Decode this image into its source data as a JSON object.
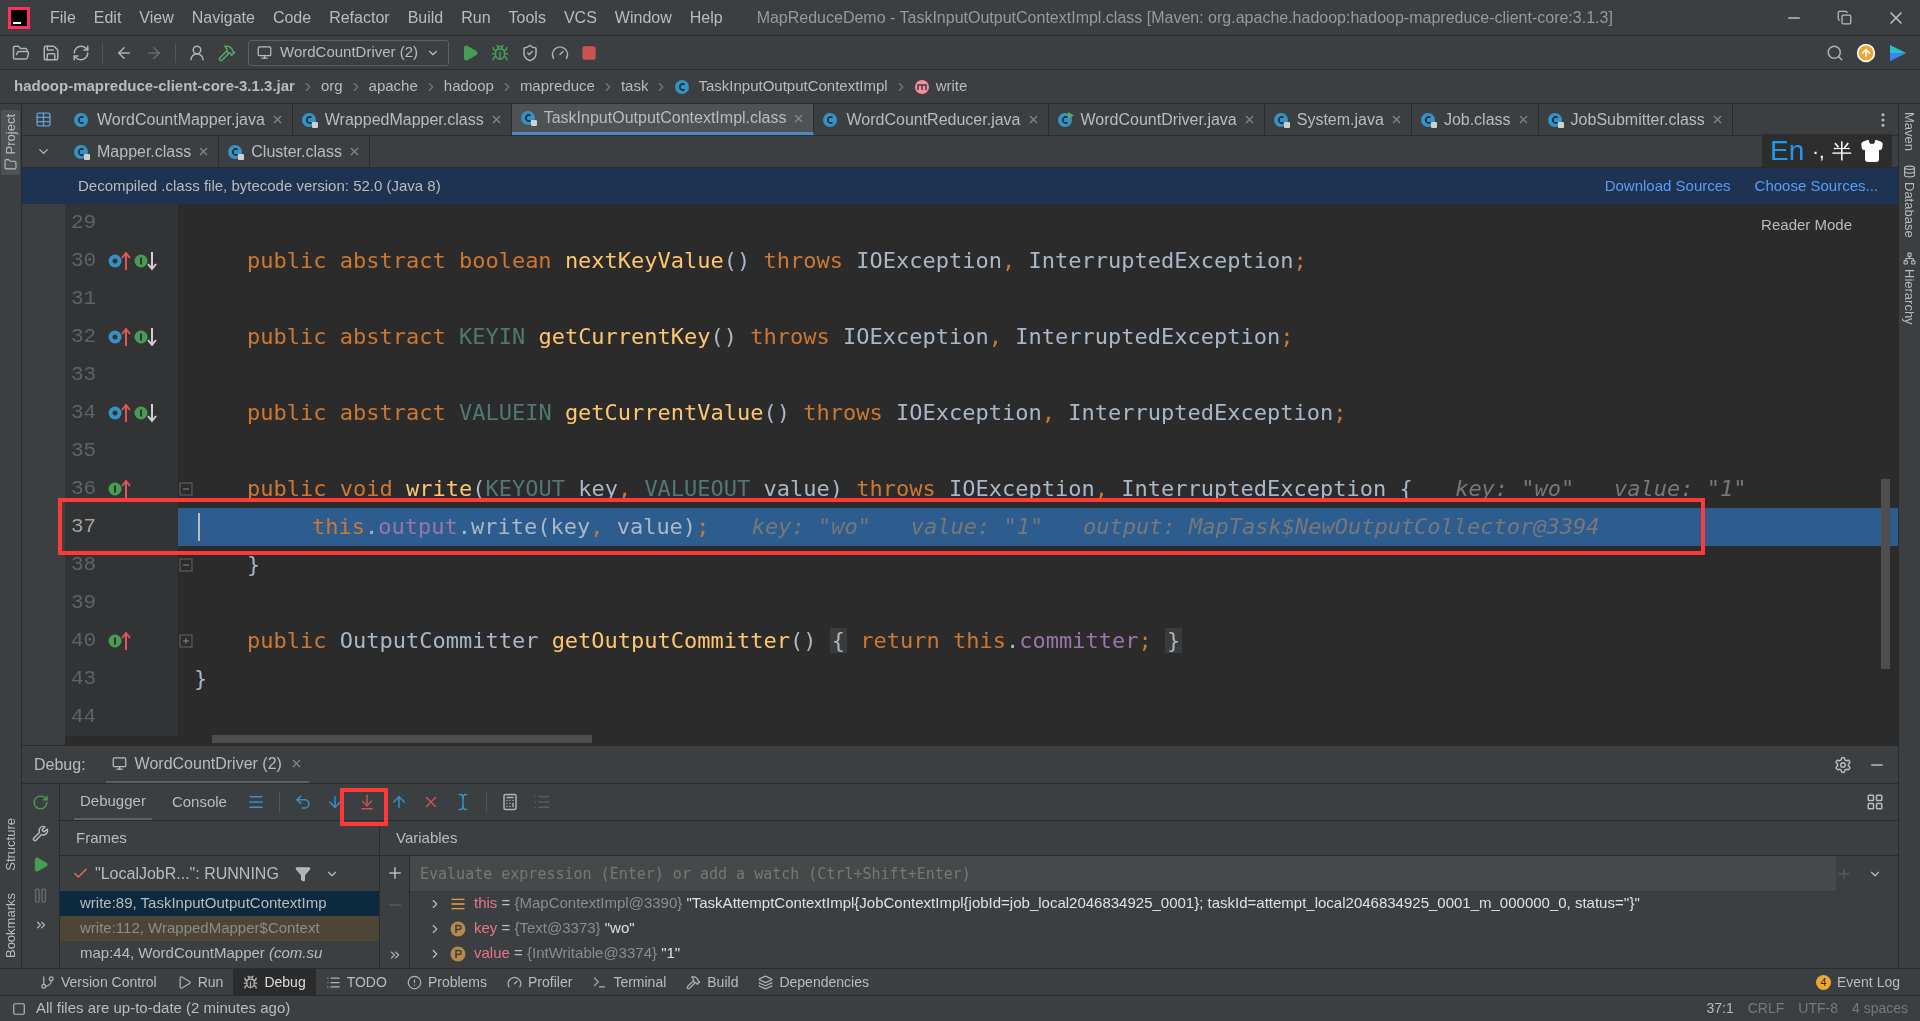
{
  "window": {
    "title": "MapReduceDemo - TaskInputOutputContextImpl.class [Maven: org.apache.hadoop:hadoop-mapreduce-client-core:3.1.3]"
  },
  "menu": [
    "File",
    "Edit",
    "View",
    "Navigate",
    "Code",
    "Refactor",
    "Build",
    "Run",
    "Tools",
    "VCS",
    "Window",
    "Help"
  ],
  "toolbar": {
    "run_config": "WordCountDriver (2)"
  },
  "breadcrumbs": [
    {
      "label": "hadoop-mapreduce-client-core-3.1.3.jar",
      "kind": "jar"
    },
    {
      "label": "org",
      "kind": "package"
    },
    {
      "label": "apache",
      "kind": "package"
    },
    {
      "label": "hadoop",
      "kind": "package"
    },
    {
      "label": "mapreduce",
      "kind": "package"
    },
    {
      "label": "task",
      "kind": "package"
    },
    {
      "label": "TaskInputOutputContextImpl",
      "kind": "class"
    },
    {
      "label": "write",
      "kind": "method"
    }
  ],
  "tab_rows": [
    {
      "tabs": [
        {
          "label": "WordCountMapper.java",
          "kind": "source",
          "selected": false
        },
        {
          "label": "WrappedMapper.class",
          "kind": "library",
          "selected": false
        },
        {
          "label": "TaskInputOutputContextImpl.class",
          "kind": "library",
          "selected": true
        },
        {
          "label": "WordCountReducer.java",
          "kind": "source",
          "selected": false
        },
        {
          "label": "WordCountDriver.java",
          "kind": "runnable",
          "selected": false
        },
        {
          "label": "System.java",
          "kind": "library",
          "selected": false
        },
        {
          "label": "Job.class",
          "kind": "library",
          "selected": false
        },
        {
          "label": "JobSubmitter.class",
          "kind": "library",
          "selected": false
        }
      ]
    },
    {
      "tabs": [
        {
          "label": "Mapper.class",
          "kind": "library",
          "selected": false
        },
        {
          "label": "Cluster.class",
          "kind": "library",
          "selected": false
        }
      ]
    }
  ],
  "banner": {
    "text": "Decompiled .class file, bytecode version: 52.0 (Java 8)",
    "links": [
      "Download Sources",
      "Choose Sources..."
    ]
  },
  "ime": {
    "mode": "En",
    "punct": "·,",
    "width": "半"
  },
  "reader_mode": "Reader Mode",
  "code_lines": [
    {
      "number": "29",
      "current": false
    },
    {
      "number": "30",
      "current": false,
      "markers": [
        {
          "kind": "o_up"
        },
        {
          "kind": "i_down"
        }
      ],
      "tokens": [
        {
          "kind": "kw",
          "text": "    public abstract boolean "
        },
        {
          "kind": "fn",
          "text": "nextKeyValue"
        },
        {
          "kind": "plain",
          "text": "() "
        },
        {
          "kind": "kw",
          "text": "throws "
        },
        {
          "kind": "plain",
          "text": "IOException"
        },
        {
          "kind": "kw",
          "text": ", "
        },
        {
          "kind": "plain",
          "text": "InterruptedException"
        },
        {
          "kind": "kw",
          "text": ";"
        }
      ]
    },
    {
      "number": "31",
      "current": false
    },
    {
      "number": "32",
      "current": false,
      "markers": [
        {
          "kind": "o_up"
        },
        {
          "kind": "i_down"
        }
      ],
      "tokens": [
        {
          "kind": "kw",
          "text": "    public abstract "
        },
        {
          "kind": "type",
          "text": "KEYIN "
        },
        {
          "kind": "fn",
          "text": "getCurrentKey"
        },
        {
          "kind": "plain",
          "text": "() "
        },
        {
          "kind": "kw",
          "text": "throws "
        },
        {
          "kind": "plain",
          "text": "IOException"
        },
        {
          "kind": "kw",
          "text": ", "
        },
        {
          "kind": "plain",
          "text": "InterruptedException"
        },
        {
          "kind": "kw",
          "text": ";"
        }
      ]
    },
    {
      "number": "33",
      "current": false
    },
    {
      "number": "34",
      "current": false,
      "markers": [
        {
          "kind": "o_up"
        },
        {
          "kind": "i_down"
        }
      ],
      "tokens": [
        {
          "kind": "kw",
          "text": "    public abstract "
        },
        {
          "kind": "type",
          "text": "VALUEIN "
        },
        {
          "kind": "fn",
          "text": "getCurrentValue"
        },
        {
          "kind": "plain",
          "text": "() "
        },
        {
          "kind": "kw",
          "text": "throws "
        },
        {
          "kind": "plain",
          "text": "IOException"
        },
        {
          "kind": "kw",
          "text": ", "
        },
        {
          "kind": "plain",
          "text": "InterruptedException"
        },
        {
          "kind": "kw",
          "text": ";"
        }
      ]
    },
    {
      "number": "35",
      "current": false
    },
    {
      "number": "36",
      "current": false,
      "fold": {
        "kind": "minus"
      },
      "markers": [
        {
          "kind": "i_up"
        }
      ],
      "tokens": [
        {
          "kind": "kw",
          "text": "    public void "
        },
        {
          "kind": "fn",
          "text": "write"
        },
        {
          "kind": "plain",
          "text": "("
        },
        {
          "kind": "type",
          "text": "KEYOUT"
        },
        {
          "kind": "plain",
          "text": " key"
        },
        {
          "kind": "kw",
          "text": ", "
        },
        {
          "kind": "type",
          "text": "VALUEOUT"
        },
        {
          "kind": "plain",
          "text": " value) "
        },
        {
          "kind": "kw",
          "text": "throws "
        },
        {
          "kind": "plain",
          "text": "IOException"
        },
        {
          "kind": "kw",
          "text": ", "
        },
        {
          "kind": "plain",
          "text": "InterruptedException {"
        },
        {
          "kind": "hint",
          "text": "  key: \"wo\"   value: \"1\""
        }
      ]
    },
    {
      "number": "37",
      "current": true,
      "tokens": [
        {
          "kind": "kw",
          "text": "        this"
        },
        {
          "kind": "plain",
          "text": "."
        },
        {
          "kind": "field",
          "text": "output"
        },
        {
          "kind": "plain",
          "text": ".write(key"
        },
        {
          "kind": "kw",
          "text": ", "
        },
        {
          "kind": "plain",
          "text": "value)"
        },
        {
          "kind": "kw",
          "text": ";"
        },
        {
          "kind": "hint",
          "text": "  key: \"wo\"   value: \"1\"   output: MapTask$NewOutputCollector@3394"
        }
      ]
    },
    {
      "number": "38",
      "current": false,
      "fold": {
        "kind": "minus"
      },
      "tokens": [
        {
          "kind": "plain",
          "text": "    }"
        }
      ]
    },
    {
      "number": "39",
      "current": false
    },
    {
      "number": "40",
      "current": false,
      "fold": {
        "kind": "plus"
      },
      "markers": [
        {
          "kind": "i_up"
        }
      ],
      "tokens": [
        {
          "kind": "kw",
          "text": "    public "
        },
        {
          "kind": "plain",
          "text": "OutputCommitter "
        },
        {
          "kind": "fn",
          "text": "getOutputCommitter"
        },
        {
          "kind": "plain",
          "text": "() "
        },
        {
          "kind": "folded",
          "text": "{"
        },
        {
          "kind": "kw",
          "text": " return this"
        },
        {
          "kind": "plain",
          "text": "."
        },
        {
          "kind": "field",
          "text": "committer"
        },
        {
          "kind": "kw",
          "text": "; "
        },
        {
          "kind": "folded",
          "text": "}"
        }
      ]
    },
    {
      "number": "43",
      "current": false,
      "tokens": [
        {
          "kind": "plain",
          "text": "}"
        }
      ]
    },
    {
      "number": "44",
      "current": false
    }
  ],
  "side_tools": {
    "left_top": [
      "Project"
    ],
    "left_bottom": [
      "Structure",
      "Bookmarks"
    ],
    "right": [
      "Maven",
      "Database",
      "Hierarchy"
    ]
  },
  "debug": {
    "label": "Debug:",
    "session": "WordCountDriver (2)",
    "tabs": [
      {
        "label": "Debugger",
        "selected": true
      },
      {
        "label": "Console",
        "selected": false
      }
    ],
    "frames_title": "Frames",
    "variables_title": "Variables",
    "thread": "\"LocalJobR...\": RUNNING",
    "frames": [
      {
        "text": "write:89, TaskInputOutputContextImp",
        "kind": "normal",
        "selected": true
      },
      {
        "text": "write:112, WrappedMapper$Context",
        "kind": "library",
        "selected": false
      },
      {
        "text": "map:44, WordCountMapper *(com.su*",
        "kind": "normal",
        "selected": false
      }
    ],
    "watch_placeholder": "Evaluate expression (Enter) or add a watch (Ctrl+Shift+Enter)",
    "variables": [
      {
        "kind": "object",
        "name": "this",
        "op": "=",
        "type": "{MapContextImpl@3390}",
        "value": "\"TaskAttemptContextImpl{JobContextImpl{jobId=job_local2046834925_0001}; taskId=attempt_local2046834925_0001_m_000000_0, status=''}\""
      },
      {
        "kind": "param",
        "name": "key",
        "op": "=",
        "type": "{Text@3373}",
        "value": "\"wo\""
      },
      {
        "kind": "param",
        "name": "value",
        "op": "=",
        "type": "{IntWritable@3374}",
        "value": "\"1\""
      }
    ]
  },
  "tool_windows": [
    {
      "label": "Version Control",
      "kind": "vcs",
      "selected": false
    },
    {
      "label": "Run",
      "kind": "run",
      "selected": false
    },
    {
      "label": "Debug",
      "kind": "debug",
      "selected": true
    },
    {
      "label": "TODO",
      "kind": "todo",
      "selected": false
    },
    {
      "label": "Problems",
      "kind": "problems",
      "selected": false
    },
    {
      "label": "Profiler",
      "kind": "profiler",
      "selected": false
    },
    {
      "label": "Terminal",
      "kind": "terminal",
      "selected": false
    },
    {
      "label": "Build",
      "kind": "build",
      "selected": false
    },
    {
      "label": "Dependencies",
      "kind": "dependencies",
      "selected": false
    }
  ],
  "event_log": {
    "count": "4",
    "label": "Event Log"
  },
  "status_bar": {
    "message": "All files are up-to-date (2 minutes ago)",
    "items": [
      "37:1",
      "CRLF",
      "UTF-8",
      "4 spaces"
    ]
  }
}
